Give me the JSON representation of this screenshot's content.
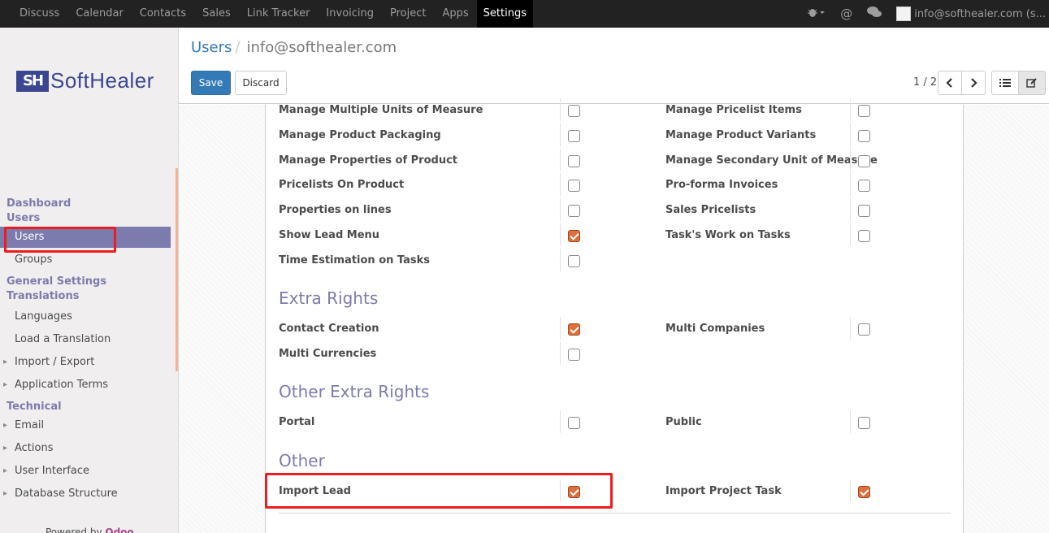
{
  "topbar": {
    "menu": [
      "Discuss",
      "Calendar",
      "Contacts",
      "Sales",
      "Link Tracker",
      "Invoicing",
      "Project",
      "Apps",
      "Settings"
    ],
    "active": "Settings",
    "user": "info@softhealer.com (s..."
  },
  "sidebar": {
    "logo_mark": "SH",
    "logo_text": "SoftHealer",
    "groups": [
      {
        "header": "Dashboard",
        "items": []
      },
      {
        "header": "Users",
        "items": [
          "Users",
          "Groups"
        ]
      },
      {
        "header": "General Settings",
        "items": []
      },
      {
        "header": "Translations",
        "items": [
          "Languages",
          "Load a Translation",
          "Import / Export",
          "Application Terms"
        ]
      },
      {
        "header": "Technical",
        "items": [
          "Email",
          "Actions",
          "User Interface",
          "Database Structure"
        ]
      }
    ],
    "powered_prefix": "Powered by",
    "powered_brand": "Odoo"
  },
  "breadcrumb": {
    "parent": "Users",
    "current": "info@softhealer.com"
  },
  "buttons": {
    "save": "Save",
    "discard": "Discard"
  },
  "pager": {
    "text": "1 / 2"
  },
  "form": {
    "rows_top": [
      {
        "left": "Manage Multiple Units of Measure",
        "left_checked": false,
        "right": "Manage Pricelist Items",
        "right_checked": false
      },
      {
        "left": "Manage Product Packaging",
        "left_checked": false,
        "right": "Manage Product Variants",
        "right_checked": false
      },
      {
        "left": "Manage Properties of Product",
        "left_checked": false,
        "right": "Manage Secondary Unit of Measure",
        "right_checked": false
      },
      {
        "left": "Pricelists On Product",
        "left_checked": false,
        "right": "Pro-forma Invoices",
        "right_checked": false
      },
      {
        "left": "Properties on lines",
        "left_checked": false,
        "right": "Sales Pricelists",
        "right_checked": false
      },
      {
        "left": "Show Lead Menu",
        "left_checked": true,
        "right": "Task's Work on Tasks",
        "right_checked": false
      },
      {
        "left": "Time Estimation on Tasks",
        "left_checked": false
      }
    ],
    "sections": [
      {
        "title": "Extra Rights",
        "rows": [
          {
            "left": "Contact Creation",
            "left_checked": true,
            "right": "Multi Companies",
            "right_checked": false
          },
          {
            "left": "Multi Currencies",
            "left_checked": false
          }
        ]
      },
      {
        "title": "Other Extra Rights",
        "rows": [
          {
            "left": "Portal",
            "left_checked": false,
            "right": "Public",
            "right_checked": false
          }
        ]
      },
      {
        "title": "Other",
        "rows": [
          {
            "left": "Import Lead",
            "left_checked": true,
            "right": "Import Project Task",
            "right_checked": true
          }
        ]
      }
    ]
  },
  "colors": {
    "accent": "#7c7bad",
    "primary": "#337ab7",
    "checkbox_on": "#e06e3c",
    "highlight": "#ee1c1c"
  }
}
